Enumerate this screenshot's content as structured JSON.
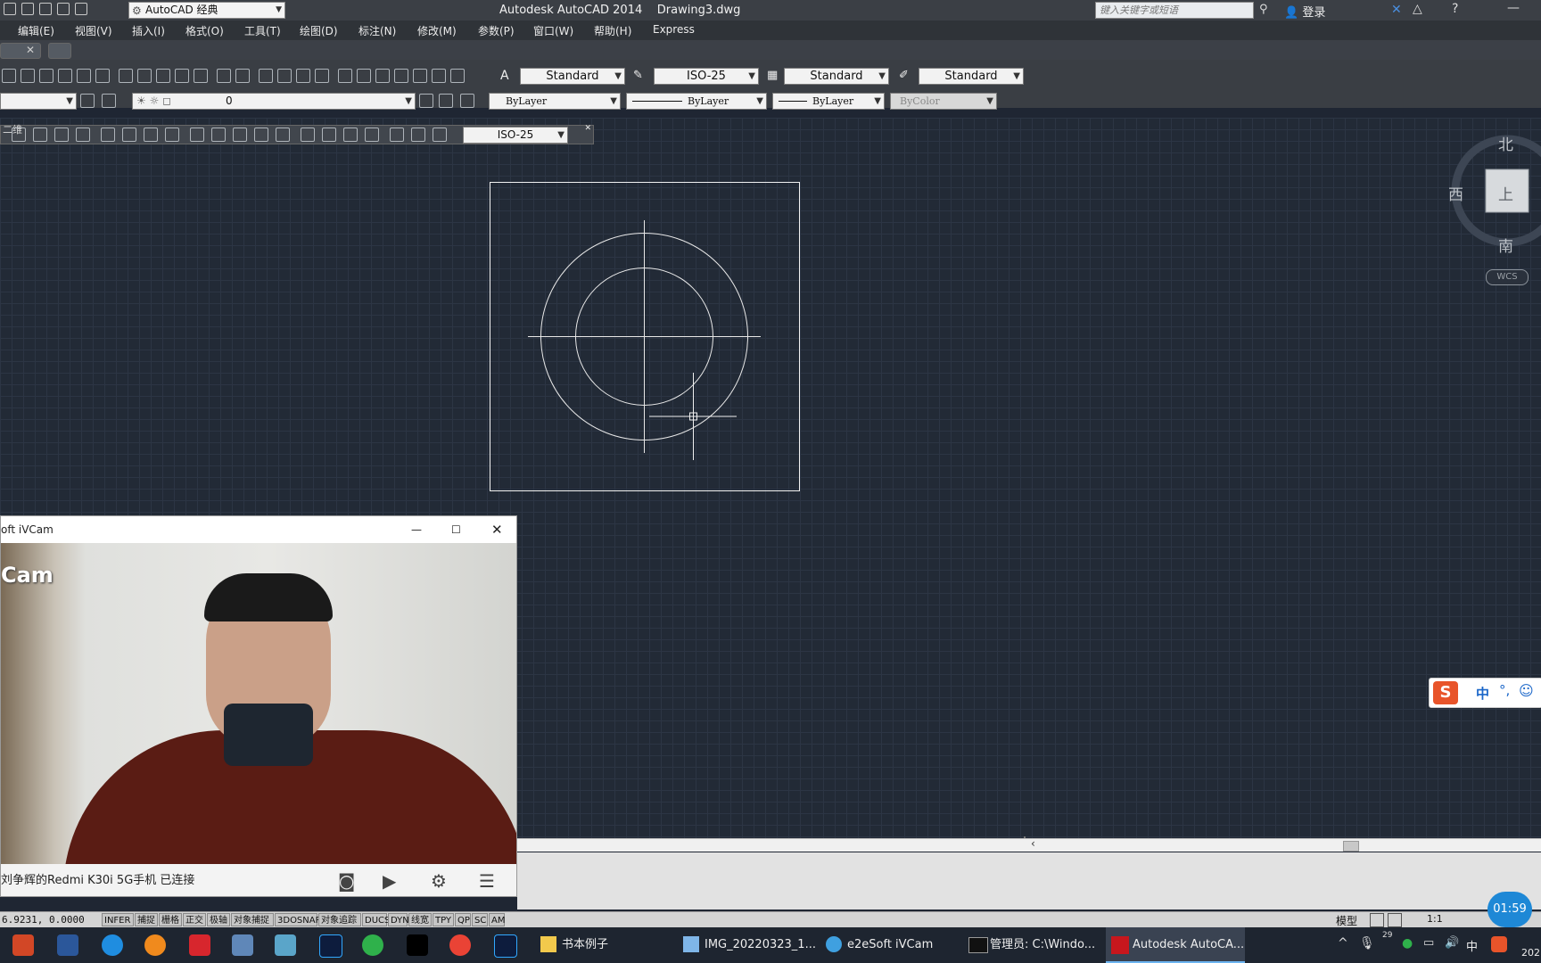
{
  "window": {
    "app_title": "Autodesk AutoCAD 2014    Drawing3.dwg",
    "workspace": "AutoCAD 经典",
    "search_placeholder": "键入关键字或短语",
    "login": "登录"
  },
  "menu": [
    "编辑(E)",
    "视图(V)",
    "插入(I)",
    "格式(O)",
    "工具(T)",
    "绘图(D)",
    "标注(N)",
    "修改(M)",
    "参数(P)",
    "窗口(W)",
    "帮助(H)",
    "Express"
  ],
  "styles_toolbar": {
    "text_style": "Standard",
    "dim_style": "ISO-25",
    "table_style": "Standard",
    "mleader_style": "Standard"
  },
  "layers_toolbar": {
    "layer": "0",
    "color": "ByLayer",
    "linetype": "ByLayer",
    "lineweight": "ByLayer",
    "plotstyle": "ByColor"
  },
  "dim_toolbar": {
    "label": "二维",
    "dim_style": "ISO-25"
  },
  "viewcube": {
    "north": "北",
    "west": "西",
    "south": "南",
    "top": "上",
    "wcs": "WCS"
  },
  "ivcam": {
    "title": "oft iVCam",
    "watermark": "Cam",
    "status": "刘争辉的Redmi K30i 5G手机 已连接"
  },
  "statusbar": {
    "coords": "6.9231, 0.0000",
    "toggles": [
      "INFER",
      "捕捉",
      "栅格",
      "正交",
      "极轴",
      "对象捕捉",
      "3DOSNAP",
      "对象追踪",
      "DUCS",
      "DYN",
      "线宽",
      "TPY",
      "QP",
      "SC",
      "AM"
    ],
    "model": "模型",
    "scale": "1:1"
  },
  "taskbar": {
    "tasks": [
      "书本例子",
      "IMG_20220323_1...",
      "e2eSoft iVCam",
      "管理员: C:\\Windo...",
      "Autodesk AutoCA..."
    ],
    "ime_lang": "中",
    "temp": "29",
    "clock_badge": "01:59",
    "date_fragment": "202"
  },
  "ime_bar": {
    "mode": "中"
  },
  "colors": {
    "canvas": "#222a36",
    "grid": "#2c3544",
    "accent": "#1e88d6"
  }
}
